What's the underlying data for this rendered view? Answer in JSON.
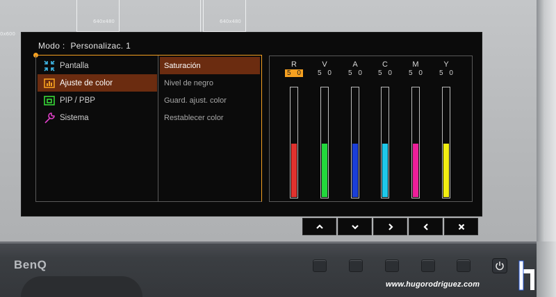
{
  "background": {
    "grid_labels": [
      "640x480",
      "640x480",
      "0x600"
    ]
  },
  "osd": {
    "mode_label": "Modo :",
    "mode_value": "Personalizac. 1",
    "menu": [
      {
        "label": "Pantalla",
        "icon": "display-adjust-icon",
        "active": false
      },
      {
        "label": "Ajuste de color",
        "icon": "color-adjust-icon",
        "active": true
      },
      {
        "label": "PIP / PBP",
        "icon": "pip-pbp-icon",
        "active": false
      },
      {
        "label": "Sistema",
        "icon": "wrench-icon",
        "active": false
      }
    ],
    "submenu": [
      {
        "label": "Saturación",
        "active": true
      },
      {
        "label": "Nivel de negro",
        "active": false
      },
      {
        "label": "Guard. ajust. color",
        "active": false
      },
      {
        "label": "Restablecer color",
        "active": false
      }
    ],
    "channels": [
      {
        "label": "R",
        "value": "5 0",
        "level": 0.5,
        "color": "#e0322e",
        "active": true
      },
      {
        "label": "V",
        "value": "5 0",
        "level": 0.5,
        "color": "#22d83c",
        "active": false
      },
      {
        "label": "A",
        "value": "5 0",
        "level": 0.5,
        "color": "#1b3fd8",
        "active": false
      },
      {
        "label": "C",
        "value": "5 0",
        "level": 0.5,
        "color": "#1ec8ea",
        "active": false
      },
      {
        "label": "M",
        "value": "5 0",
        "level": 0.5,
        "color": "#ee1e9a",
        "active": false
      },
      {
        "label": "Y",
        "value": "5 0",
        "level": 0.5,
        "color": "#f2ee12",
        "active": false
      }
    ],
    "accent_color": "#f5a020",
    "active_bg_color": "#6b2c10"
  },
  "nav_buttons": [
    {
      "name": "up-icon",
      "glyph": "up"
    },
    {
      "name": "down-icon",
      "glyph": "down"
    },
    {
      "name": "right-icon",
      "glyph": "right"
    },
    {
      "name": "left-icon",
      "glyph": "left"
    },
    {
      "name": "close-icon",
      "glyph": "x"
    }
  ],
  "bezel": {
    "brand": "BenQ",
    "watermark": "www.hugorodriguez.com"
  }
}
